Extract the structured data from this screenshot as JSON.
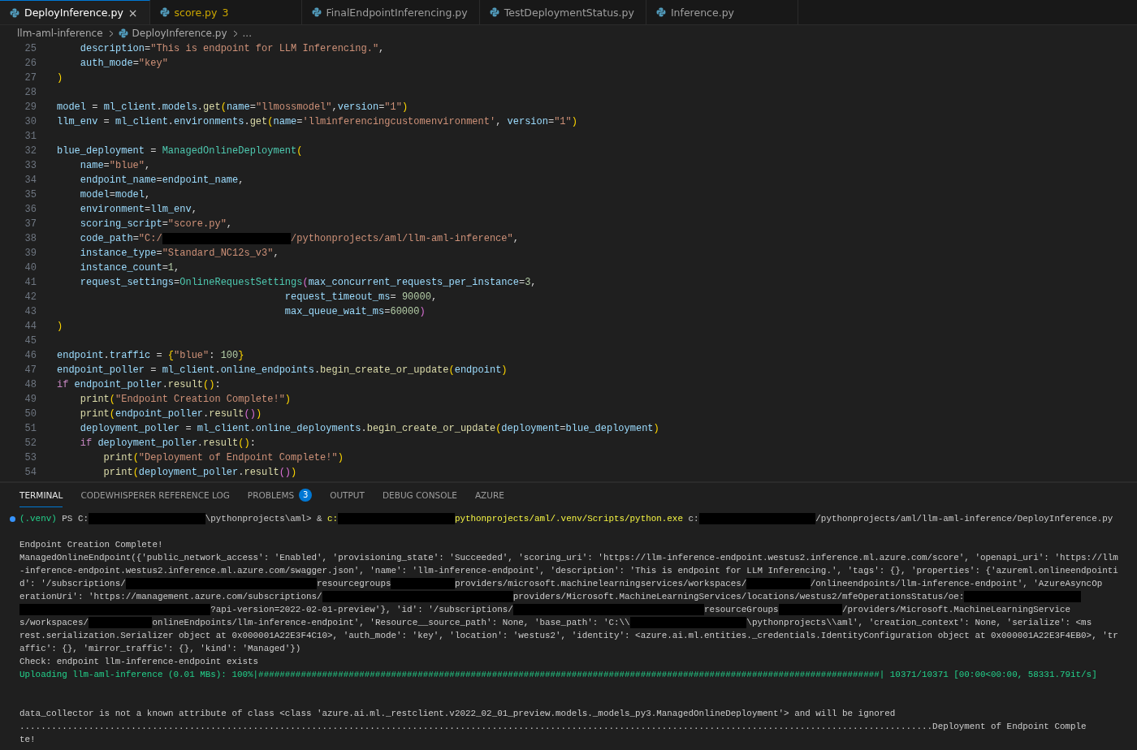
{
  "tabs": [
    {
      "label": "DeployInference.py",
      "selected": true,
      "warning": false,
      "close": "×"
    },
    {
      "label": "score.py",
      "selected": false,
      "warning": true,
      "badge": "3"
    },
    {
      "label": "FinalEndpointInferencing.py",
      "selected": false,
      "warning": false
    },
    {
      "label": "TestDeploymentStatus.py",
      "selected": false,
      "warning": false
    },
    {
      "label": "Inference.py",
      "selected": false,
      "warning": false
    }
  ],
  "breadcrumbs": {
    "folder": "llm-aml-inference",
    "file": "DeployInference.py",
    "more": "..."
  },
  "editor": {
    "lines": [
      {
        "no": "25",
        "tokens": [
          {
            "kind": "variable",
            "t": "    description"
          },
          {
            "kind": "punct",
            "t": "="
          },
          {
            "kind": "string",
            "t": "\"This is endpoint for LLM Inferencing.\""
          },
          {
            "kind": "punct",
            "t": ","
          }
        ]
      },
      {
        "no": "26",
        "tokens": [
          {
            "kind": "variable",
            "t": "    auth_mode"
          },
          {
            "kind": "punct",
            "t": "="
          },
          {
            "kind": "string",
            "t": "\"key\""
          }
        ]
      },
      {
        "no": "27",
        "tokens": [
          {
            "kind": "bracket",
            "t": ")"
          }
        ]
      },
      {
        "no": "28"
      },
      {
        "no": "29",
        "tokens": [
          {
            "kind": "variable",
            "t": "model"
          },
          {
            "kind": "punct",
            "t": " = "
          },
          {
            "kind": "variable",
            "t": "ml_client"
          },
          {
            "kind": "punct",
            "t": "."
          },
          {
            "kind": "variable",
            "t": "models"
          },
          {
            "kind": "punct",
            "t": "."
          },
          {
            "kind": "function",
            "t": "get"
          },
          {
            "kind": "bracket",
            "t": "("
          },
          {
            "kind": "variable",
            "t": "name"
          },
          {
            "kind": "punct",
            "t": "="
          },
          {
            "kind": "string",
            "t": "\"llmossmodel\""
          },
          {
            "kind": "punct",
            "t": ","
          },
          {
            "kind": "variable",
            "t": "version"
          },
          {
            "kind": "punct",
            "t": "="
          },
          {
            "kind": "string",
            "t": "\"1\""
          },
          {
            "kind": "bracket",
            "t": ")"
          }
        ]
      },
      {
        "no": "30",
        "tokens": [
          {
            "kind": "variable",
            "t": "llm_env"
          },
          {
            "kind": "punct",
            "t": " = "
          },
          {
            "kind": "variable",
            "t": "ml_client"
          },
          {
            "kind": "punct",
            "t": "."
          },
          {
            "kind": "variable",
            "t": "environments"
          },
          {
            "kind": "punct",
            "t": "."
          },
          {
            "kind": "function",
            "t": "get"
          },
          {
            "kind": "bracket",
            "t": "("
          },
          {
            "kind": "variable",
            "t": "name"
          },
          {
            "kind": "punct",
            "t": "="
          },
          {
            "kind": "string",
            "t": "'llminferencingcustomenvironment'"
          },
          {
            "kind": "punct",
            "t": ", "
          },
          {
            "kind": "variable",
            "t": "version"
          },
          {
            "kind": "punct",
            "t": "="
          },
          {
            "kind": "string",
            "t": "\"1\""
          },
          {
            "kind": "bracket",
            "t": ")"
          }
        ]
      },
      {
        "no": "31"
      },
      {
        "no": "32",
        "tokens": [
          {
            "kind": "variable",
            "t": "blue_deployment"
          },
          {
            "kind": "punct",
            "t": " = "
          },
          {
            "kind": "type",
            "t": "ManagedOnlineDeployment"
          },
          {
            "kind": "bracket",
            "t": "("
          }
        ]
      },
      {
        "no": "33",
        "tokens": [
          {
            "kind": "variable",
            "t": "    name"
          },
          {
            "kind": "punct",
            "t": "="
          },
          {
            "kind": "string",
            "t": "\"blue\""
          },
          {
            "kind": "punct",
            "t": ","
          }
        ]
      },
      {
        "no": "34",
        "tokens": [
          {
            "kind": "variable",
            "t": "    endpoint_name"
          },
          {
            "kind": "punct",
            "t": "="
          },
          {
            "kind": "variable",
            "t": "endpoint_name"
          },
          {
            "kind": "punct",
            "t": ","
          }
        ]
      },
      {
        "no": "35",
        "tokens": [
          {
            "kind": "variable",
            "t": "    model"
          },
          {
            "kind": "punct",
            "t": "="
          },
          {
            "kind": "variable",
            "t": "model"
          },
          {
            "kind": "punct",
            "t": ","
          }
        ]
      },
      {
        "no": "36",
        "tokens": [
          {
            "kind": "variable",
            "t": "    environment"
          },
          {
            "kind": "punct",
            "t": "="
          },
          {
            "kind": "variable",
            "t": "llm_env"
          },
          {
            "kind": "punct",
            "t": ","
          }
        ]
      },
      {
        "no": "37",
        "tokens": [
          {
            "kind": "variable",
            "t": "    scoring_script"
          },
          {
            "kind": "punct",
            "t": "="
          },
          {
            "kind": "string",
            "t": "\"score.py\""
          },
          {
            "kind": "punct",
            "t": ","
          }
        ]
      },
      {
        "no": "38",
        "tokens": [
          {
            "kind": "variable",
            "t": "    code_path"
          },
          {
            "kind": "punct",
            "t": "="
          },
          {
            "kind": "string",
            "t": "\"C:/"
          },
          {
            "kind": "mask_m"
          },
          {
            "kind": "string",
            "t": "/pythonprojects/aml/llm-aml-inference\""
          },
          {
            "kind": "punct",
            "t": ","
          }
        ]
      },
      {
        "no": "39",
        "tokens": [
          {
            "kind": "variable",
            "t": "    instance_type"
          },
          {
            "kind": "punct",
            "t": "="
          },
          {
            "kind": "string",
            "t": "\"Standard_NC12s_v3\""
          },
          {
            "kind": "punct",
            "t": ","
          }
        ]
      },
      {
        "no": "40",
        "tokens": [
          {
            "kind": "variable",
            "t": "    instance_count"
          },
          {
            "kind": "punct",
            "t": "="
          },
          {
            "kind": "number",
            "t": "1"
          },
          {
            "kind": "punct",
            "t": ","
          }
        ]
      },
      {
        "no": "41",
        "tokens": [
          {
            "kind": "variable",
            "t": "    request_settings"
          },
          {
            "kind": "punct",
            "t": "="
          },
          {
            "kind": "type",
            "t": "OnlineRequestSettings"
          },
          {
            "kind": "bracket2",
            "t": "("
          },
          {
            "kind": "variable",
            "t": "max_concurrent_requests_per_instance"
          },
          {
            "kind": "punct",
            "t": "="
          },
          {
            "kind": "number",
            "t": "3"
          },
          {
            "kind": "punct",
            "t": ","
          }
        ]
      },
      {
        "no": "42",
        "tokens": [
          {
            "kind": "variable",
            "t": "                                       request_timeout_ms"
          },
          {
            "kind": "punct",
            "t": "= "
          },
          {
            "kind": "number",
            "t": "90000"
          },
          {
            "kind": "punct",
            "t": ","
          }
        ]
      },
      {
        "no": "43",
        "tokens": [
          {
            "kind": "variable",
            "t": "                                       max_queue_wait_ms"
          },
          {
            "kind": "punct",
            "t": "="
          },
          {
            "kind": "number",
            "t": "60000"
          },
          {
            "kind": "bracket2",
            "t": ")"
          }
        ]
      },
      {
        "no": "44",
        "tokens": [
          {
            "kind": "bracket",
            "t": ")"
          }
        ]
      },
      {
        "no": "45"
      },
      {
        "no": "46",
        "tokens": [
          {
            "kind": "variable",
            "t": "endpoint"
          },
          {
            "kind": "punct",
            "t": "."
          },
          {
            "kind": "variable",
            "t": "traffic"
          },
          {
            "kind": "punct",
            "t": " = "
          },
          {
            "kind": "bracket",
            "t": "{"
          },
          {
            "kind": "string",
            "t": "\"blue\""
          },
          {
            "kind": "punct",
            "t": ": "
          },
          {
            "kind": "number",
            "t": "100"
          },
          {
            "kind": "bracket",
            "t": "}"
          }
        ]
      },
      {
        "no": "47",
        "tokens": [
          {
            "kind": "variable",
            "t": "endpoint_poller"
          },
          {
            "kind": "punct",
            "t": " = "
          },
          {
            "kind": "variable",
            "t": "ml_client"
          },
          {
            "kind": "punct",
            "t": "."
          },
          {
            "kind": "variable",
            "t": "online_endpoints"
          },
          {
            "kind": "punct",
            "t": "."
          },
          {
            "kind": "function",
            "t": "begin_create_or_update"
          },
          {
            "kind": "bracket",
            "t": "("
          },
          {
            "kind": "variable",
            "t": "endpoint"
          },
          {
            "kind": "bracket",
            "t": ")"
          }
        ]
      },
      {
        "no": "48",
        "tokens": [
          {
            "kind": "keyword",
            "t": "if"
          },
          {
            "kind": "variable",
            "t": " endpoint_poller"
          },
          {
            "kind": "punct",
            "t": "."
          },
          {
            "kind": "function",
            "t": "result"
          },
          {
            "kind": "bracket",
            "t": "()"
          },
          {
            "kind": "punct",
            "t": ":"
          }
        ]
      },
      {
        "no": "49",
        "tokens": [
          {
            "kind": "function",
            "t": "    print"
          },
          {
            "kind": "bracket",
            "t": "("
          },
          {
            "kind": "string",
            "t": "\"Endpoint Creation Complete!\""
          },
          {
            "kind": "bracket",
            "t": ")"
          }
        ]
      },
      {
        "no": "50",
        "tokens": [
          {
            "kind": "function",
            "t": "    print"
          },
          {
            "kind": "bracket",
            "t": "("
          },
          {
            "kind": "variable",
            "t": "endpoint_poller"
          },
          {
            "kind": "punct",
            "t": "."
          },
          {
            "kind": "function",
            "t": "result"
          },
          {
            "kind": "bracket2",
            "t": "()"
          },
          {
            "kind": "bracket",
            "t": ")"
          }
        ]
      },
      {
        "no": "51",
        "tokens": [
          {
            "kind": "variable",
            "t": "    deployment_poller"
          },
          {
            "kind": "punct",
            "t": " = "
          },
          {
            "kind": "variable",
            "t": "ml_client"
          },
          {
            "kind": "punct",
            "t": "."
          },
          {
            "kind": "variable",
            "t": "online_deployments"
          },
          {
            "kind": "punct",
            "t": "."
          },
          {
            "kind": "function",
            "t": "begin_create_or_update"
          },
          {
            "kind": "bracket",
            "t": "("
          },
          {
            "kind": "variable",
            "t": "deployment"
          },
          {
            "kind": "punct",
            "t": "="
          },
          {
            "kind": "variable",
            "t": "blue_deployment"
          },
          {
            "kind": "bracket",
            "t": ")"
          }
        ]
      },
      {
        "no": "52",
        "tokens": [
          {
            "kind": "keyword",
            "t": "    if"
          },
          {
            "kind": "variable",
            "t": " deployment_poller"
          },
          {
            "kind": "punct",
            "t": "."
          },
          {
            "kind": "function",
            "t": "result"
          },
          {
            "kind": "bracket",
            "t": "()"
          },
          {
            "kind": "punct",
            "t": ":"
          }
        ]
      },
      {
        "no": "53",
        "tokens": [
          {
            "kind": "function",
            "t": "        print"
          },
          {
            "kind": "bracket",
            "t": "("
          },
          {
            "kind": "string",
            "t": "\"Deployment of Endpoint Complete!\""
          },
          {
            "kind": "bracket",
            "t": ")"
          }
        ]
      },
      {
        "no": "54",
        "tokens": [
          {
            "kind": "function",
            "t": "        print"
          },
          {
            "kind": "bracket",
            "t": "("
          },
          {
            "kind": "variable",
            "t": "deployment_poller"
          },
          {
            "kind": "punct",
            "t": "."
          },
          {
            "kind": "function",
            "t": "result"
          },
          {
            "kind": "bracket2",
            "t": "()"
          },
          {
            "kind": "bracket",
            "t": ")"
          }
        ]
      }
    ]
  },
  "panel": {
    "tabs": [
      {
        "label": "TERMINAL",
        "selected": true
      },
      {
        "label": "CODEWHISPERER REFERENCE LOG",
        "selected": false
      },
      {
        "label": "PROBLEMS",
        "selected": false,
        "badge": "3"
      },
      {
        "label": "OUTPUT",
        "selected": false
      },
      {
        "label": "DEBUG CONSOLE",
        "selected": false
      },
      {
        "label": "AZURE",
        "selected": false
      }
    ],
    "terminal": [
      {
        "kind": "command",
        "segs": [
          {
            "kind": "green",
            "t": "(.venv)"
          },
          {
            "kind": "text",
            "t": " PS C:"
          },
          {
            "kind": "mask_m"
          },
          {
            "kind": "text",
            "t": "\\pythonprojects\\aml> & "
          },
          {
            "kind": "yellow",
            "t": "c:"
          },
          {
            "kind": "mask_m"
          },
          {
            "kind": "yellow",
            "t": "pythonprojects/aml/.venv/Scripts/python.exe"
          },
          {
            "kind": "text",
            "t": " c:"
          },
          {
            "kind": "mask_m"
          },
          {
            "kind": "text",
            "t": "/pythonprojects/aml/llm-aml-inference/DeployInference.py"
          }
        ]
      },
      {
        "kind": "blank"
      },
      {
        "kind": "output",
        "segs": [
          {
            "kind": "text",
            "t": "Endpoint Creation Complete!"
          }
        ]
      },
      {
        "kind": "output",
        "segs": [
          {
            "kind": "text",
            "t": "ManagedOnlineEndpoint({'public_network_access': 'Enabled', 'provisioning_state': 'Succeeded', 'scoring_uri': 'https://llm-inference-endpoint.westus2.inference.ml.azure.com/score', 'openapi_uri': 'https://llm"
          }
        ]
      },
      {
        "kind": "output",
        "segs": [
          {
            "kind": "text",
            "t": "-inference-endpoint.westus2.inference.ml.azure.com/swagger.json', 'name': 'llm-inference-endpoint', 'description': 'This is endpoint for LLM Inferencing.', 'tags': {}, 'properties': {'azureml.onlineendpointi"
          }
        ]
      },
      {
        "kind": "output",
        "segs": [
          {
            "kind": "text",
            "t": "d': '/subscriptions/"
          },
          {
            "kind": "mask_l"
          },
          {
            "kind": "text",
            "t": "resourcegroups"
          },
          {
            "kind": "mask_s"
          },
          {
            "kind": "text",
            "t": "providers/microsoft.machinelearningservices/workspaces/"
          },
          {
            "kind": "mask_s"
          },
          {
            "kind": "text",
            "t": "/onlineendpoints/llm-inference-endpoint', 'AzureAsyncOp"
          }
        ]
      },
      {
        "kind": "output",
        "segs": [
          {
            "kind": "text",
            "t": "erationUri': 'https://management.azure.com/subscriptions/"
          },
          {
            "kind": "mask_l"
          },
          {
            "kind": "text",
            "t": "providers/Microsoft.MachineLearningServices/locations/westus2/mfeOperationsStatus/oe:"
          },
          {
            "kind": "mask_m"
          }
        ]
      },
      {
        "kind": "output",
        "segs": [
          {
            "kind": "mask_l"
          },
          {
            "kind": "text",
            "t": "?api-version=2022-02-01-preview'}, 'id': '/subscriptions/"
          },
          {
            "kind": "mask_l"
          },
          {
            "kind": "text",
            "t": "resourceGroups"
          },
          {
            "kind": "mask_s"
          },
          {
            "kind": "text",
            "t": "/providers/Microsoft.MachineLearningService"
          }
        ]
      },
      {
        "kind": "output",
        "segs": [
          {
            "kind": "text",
            "t": "s/workspaces/"
          },
          {
            "kind": "mask_s"
          },
          {
            "kind": "text",
            "t": "onlineEndpoints/llm-inference-endpoint', 'Resource__source_path': None, 'base_path': 'C:\\\\"
          },
          {
            "kind": "mask_m"
          },
          {
            "kind": "text",
            "t": "\\pythonprojects\\\\aml', 'creation_context': None, 'serialize': <ms"
          }
        ]
      },
      {
        "kind": "output",
        "segs": [
          {
            "kind": "text",
            "t": "rest.serialization.Serializer object at 0x000001A22E3F4C10>, 'auth_mode': 'key', 'location': 'westus2', 'identity': <azure.ai.ml.entities._credentials.IdentityConfiguration object at 0x000001A22E3F4EB0>, 'tr"
          }
        ]
      },
      {
        "kind": "output",
        "segs": [
          {
            "kind": "text",
            "t": "affic': {}, 'mirror_traffic': {}, 'kind': 'Managed'})"
          }
        ]
      },
      {
        "kind": "output",
        "segs": [
          {
            "kind": "text",
            "t": "Check: endpoint llm-inference-endpoint exists"
          }
        ]
      },
      {
        "kind": "output",
        "segs": [
          {
            "kind": "green",
            "t": "Uploading llm-aml-inference (0.01 MBs): 100%|#####################################################################################################################| 10371/10371 [00:00<00:00, 58331.79it/s]"
          }
        ]
      },
      {
        "kind": "blank"
      },
      {
        "kind": "blank"
      },
      {
        "kind": "output",
        "segs": [
          {
            "kind": "text",
            "t": "data_collector is not a known attribute of class <class 'azure.ai.ml._restclient.v2022_02_01_preview.models._models_py3.ManagedOnlineDeployment'> and will be ignored"
          }
        ]
      },
      {
        "kind": "output",
        "segs": [
          {
            "kind": "text",
            "t": "............................................................................................................................................................................Deployment of Endpoint Comple"
          }
        ]
      },
      {
        "kind": "output",
        "segs": [
          {
            "kind": "text",
            "t": "te!"
          }
        ]
      }
    ]
  }
}
